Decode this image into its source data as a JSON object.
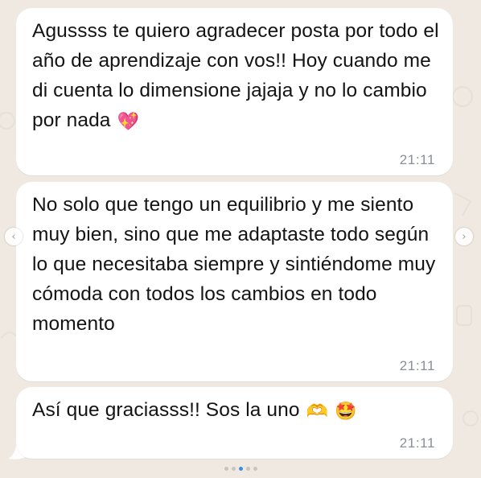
{
  "chat": {
    "messages": [
      {
        "text": "Agussss te quiero agradecer posta por todo el año de aprendizaje con vos!! Hoy cuando me di cuenta lo dimensione jajaja y no lo cambio por nada",
        "emoji": "💖",
        "emoji_name": "sparkling-heart",
        "time": "21:11"
      },
      {
        "text": "No solo que tengo un equilibrio y me siento muy bien, sino que me adaptaste todo según lo que necesitaba siempre y sintiéndome muy cómoda con todos los cambios en todo momento",
        "time": "21:11"
      },
      {
        "text": "Así que graciasss!! Sos la uno",
        "emoji": "🫶",
        "emoji_name": "heart-hands",
        "emoji2": "🤩",
        "emoji2_name": "star-struck",
        "time": "21:11"
      }
    ]
  },
  "carousel": {
    "prev_icon": "chevron-left-icon",
    "next_icon": "chevron-right-icon",
    "active_index": 2
  },
  "colors": {
    "bubble": "#ffffff",
    "background": "#efe9e1",
    "timestamp": "#8a8f93",
    "active_dot": "#3a8ee6"
  }
}
